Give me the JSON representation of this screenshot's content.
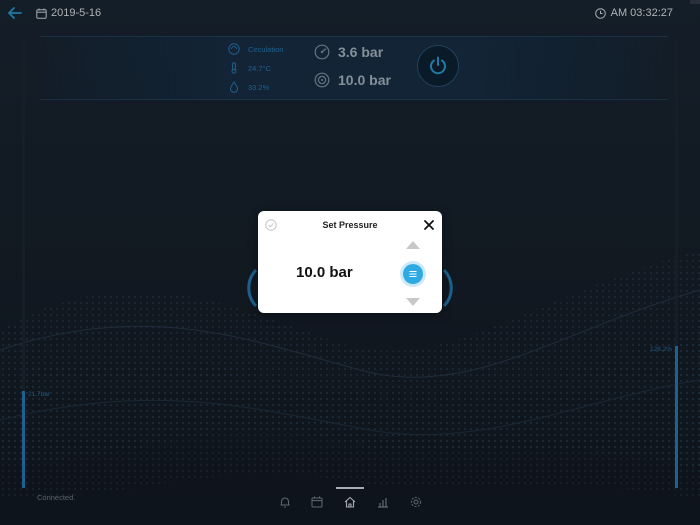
{
  "topbar": {
    "date": "2019-5-16",
    "time": "AM 03:32:27"
  },
  "status": {
    "mode": "Circulation",
    "temperature": "24.7°C",
    "humidity": "33.2%",
    "current_pressure": "3.6 bar",
    "target_pressure": "10.0 bar"
  },
  "gauges": {
    "left_label": "21.7bar",
    "right_label": "126.2%"
  },
  "footer": {
    "connection": "Connected."
  },
  "nav": {
    "items": [
      "bell-icon",
      "calendar-icon",
      "home-icon",
      "chart-icon",
      "settings-icon"
    ],
    "active": "home-icon"
  },
  "dialog": {
    "title": "Set Pressure",
    "value": "10.0 bar"
  },
  "colors": {
    "accent": "#2fa9e2",
    "status_text": "#2d85c4",
    "background": "#141c26"
  }
}
